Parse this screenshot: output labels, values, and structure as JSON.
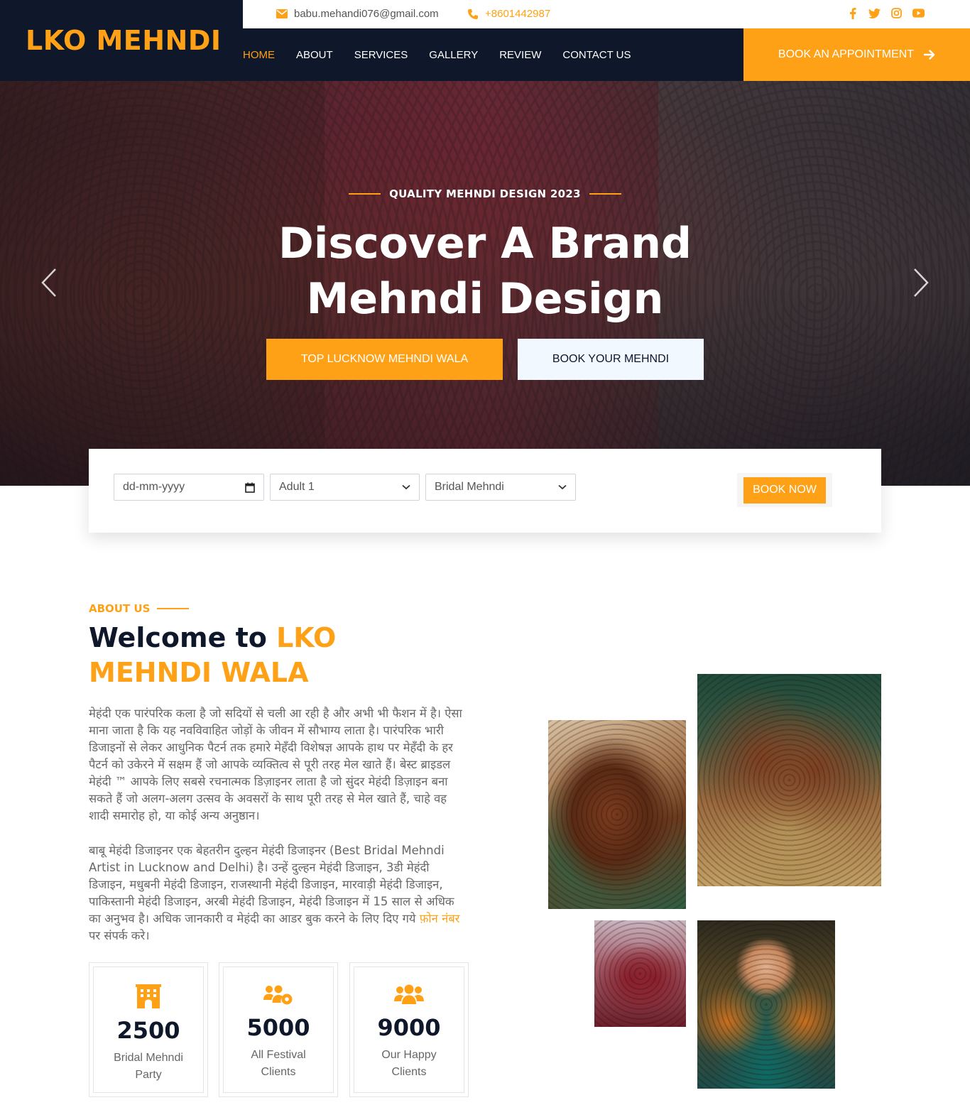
{
  "brand": {
    "name": "LKO MEHNDI"
  },
  "topbar": {
    "email": "babu.mehandi076@gmail.com",
    "phone": "+8601442987",
    "socials": [
      "facebook-icon",
      "twitter-icon",
      "instagram-icon",
      "youtube-icon"
    ]
  },
  "nav": {
    "items": [
      {
        "label": "HOME",
        "active": true
      },
      {
        "label": "ABOUT"
      },
      {
        "label": "SERVICES"
      },
      {
        "label": "GALLERY"
      },
      {
        "label": "REVIEW"
      },
      {
        "label": "CONTACT US"
      }
    ],
    "cta": "BOOK AN APPOINTMENT"
  },
  "hero": {
    "tagline": "QUALITY MEHNDI DESIGN 2023",
    "title_line1": "Discover A Brand",
    "title_line2": "Mehndi Design",
    "primary_button": "TOP LUCKNOW MEHNDI WALA",
    "secondary_button": "BOOK YOUR MEHNDI"
  },
  "booking": {
    "date_placeholder": "dd-mm-yyyy",
    "adult_selected": "Adult 1",
    "type_selected": "Bridal Mehndi",
    "submit": "BOOK NOW"
  },
  "about": {
    "label": "ABOUT US",
    "title_prefix": "Welcome to",
    "title_highlight_1": "LKO",
    "title_highlight_2": "MEHNDI WALA",
    "paragraph1": "मेहंदी एक पारंपरिक कला है जो सदियों से चली आ रही है और अभी भी फैशन में है। ऐसा माना जाता है कि यह नवविवाहित जोड़ों के जीवन में सौभाग्य लाता है। पारंपरिक भारी डिजाइनों से लेकर आधुनिक पैटर्न तक हमारे मेहँदी विशेषज्ञ आपके हाथ पर मेहँदी के हर पैटर्न को उकेरने में सक्षम हैं जो आपके व्यक्तित्व से पूरी तरह मेल खाते हैं। बेस्ट ब्राइडल मेहंदी ™ आपके लिए सबसे रचनात्मक डिज़ाइनर लाता है जो सुंदर मेहंदी डिज़ाइन बना सकते हैं जो अलग-अलग उत्सव के अवसरों के साथ पूरी तरह से मेल खाते हैं, चाहे वह शादी समारोह हो, या कोई अन्य अनुष्ठान।",
    "paragraph2_before": "बाबू मेहंदी डिजाइनर एक बेहतरीन दुल्हन मेहंदी डिजाइनर (Best Bridal Mehndi Artist in Lucknow and Delhi) है। उन्हें दुल्हन मेहंदी डिजाइन, 3डी मेहंदी डिजाइन, मधुबनी मेहंदी डिजाइन, राजस्थानी मेहंदी डिजाइन, मारवाड़ी मेहंदी डिजाइन, पाकिस्तानी मेहंदी डिजाइन, अरबी मेहंदी डिजाइन, मेहंदी डिजाइन में 15 साल से अधिक का अनुभव है। अधिक जानकारी व मेहंदी का आडर बुक करने के लिए दिए गये ",
    "paragraph2_link": "फ़ोन नंबर",
    "paragraph2_after": " पर संपर्क करे।"
  },
  "stats": [
    {
      "icon": "building-icon",
      "number": "2500",
      "label": "Bridal Mehndi Party"
    },
    {
      "icon": "users-cog-icon",
      "number": "5000",
      "label": "All Festival Clients"
    },
    {
      "icon": "users-icon",
      "number": "9000",
      "label": "Our Happy Clients"
    }
  ],
  "colors": {
    "accent": "#fea116",
    "dark": "#0f172b",
    "light": "#f1f8ff"
  }
}
